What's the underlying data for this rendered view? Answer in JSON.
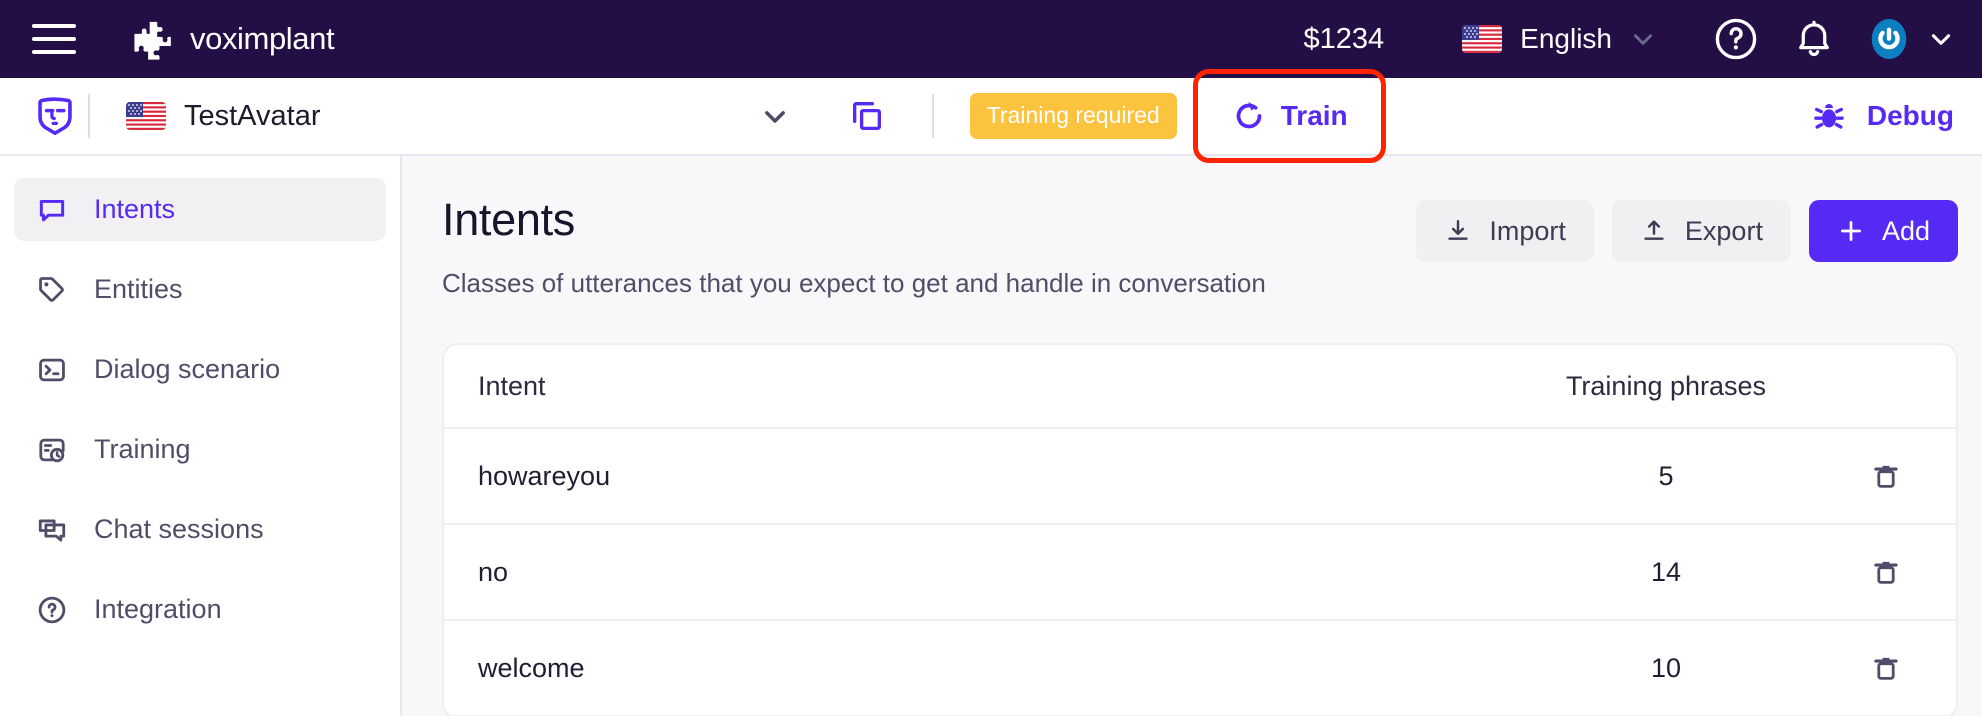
{
  "topbar": {
    "menu_icon": "hamburger-icon",
    "brand": "voximplant",
    "balance": "$1234",
    "language": "English",
    "language_flag": "us-flag-icon",
    "help_icon": "question-circle-icon",
    "notifications_icon": "bell-icon",
    "account_icon": "user-avatar-icon",
    "account_chevron": "chevron-down-icon",
    "background": "#230F45"
  },
  "subbar": {
    "bot_icon": "avatar-mask-icon",
    "avatar_flag": "us-flag-icon",
    "avatar_name": "TestAvatar",
    "avatar_chevron": "chevron-down-icon",
    "copy_icon": "copy-icon",
    "status_badge": "Training required",
    "status_badge_color": "#FCC33F",
    "train_label": "Train",
    "train_icon": "refresh-icon",
    "train_highlight_color": "#FF2400",
    "debug_label": "Debug",
    "debug_icon": "bug-icon",
    "accent": "#5729F5"
  },
  "sidebar": {
    "items": [
      {
        "label": "Intents",
        "icon": "chat-bubble-icon",
        "active": true
      },
      {
        "label": "Entities",
        "icon": "tag-icon",
        "active": false
      },
      {
        "label": "Dialog scenario",
        "icon": "terminal-icon",
        "active": false
      },
      {
        "label": "Training",
        "icon": "training-clock-icon",
        "active": false
      },
      {
        "label": "Chat sessions",
        "icon": "chat-sessions-icon",
        "active": false
      },
      {
        "label": "Integration",
        "icon": "question-circle-icon",
        "active": false
      }
    ]
  },
  "main": {
    "title": "Intents",
    "subtitle": "Classes of utterances that you expect to get and handle in conversation",
    "actions": {
      "import": "Import",
      "import_icon": "download-icon",
      "export": "Export",
      "export_icon": "upload-icon",
      "add": "Add",
      "add_icon": "plus-icon"
    },
    "table": {
      "columns": [
        "Intent",
        "Training phrases"
      ],
      "row_action_icon": "trash-icon",
      "rows": [
        {
          "intent": "howareyou",
          "phrases": "5"
        },
        {
          "intent": "no",
          "phrases": "14"
        },
        {
          "intent": "welcome",
          "phrases": "10"
        }
      ]
    }
  }
}
